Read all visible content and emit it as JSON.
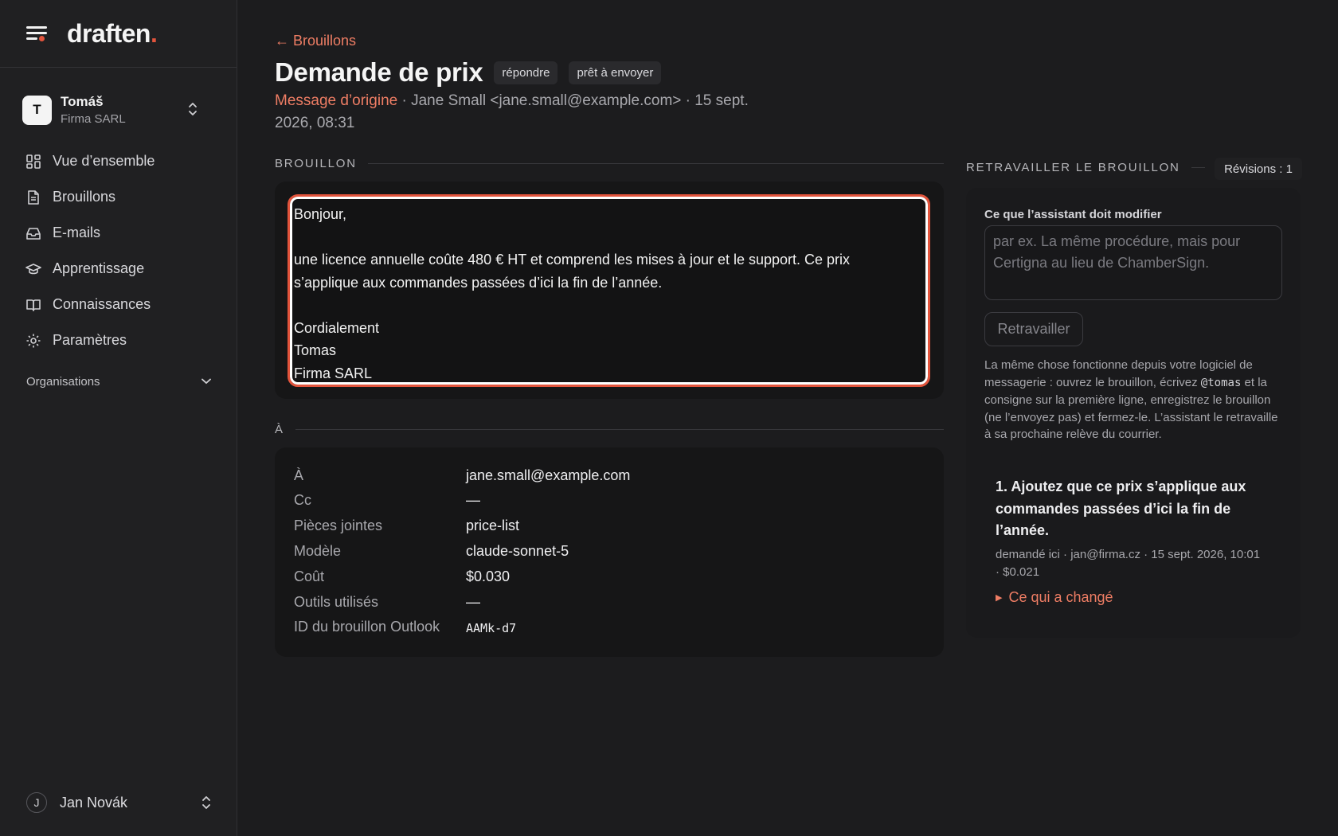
{
  "brand": {
    "name": "draften",
    "dot": "."
  },
  "workspace": {
    "initial": "T",
    "name": "Tomáš",
    "company": "Firma SARL"
  },
  "nav": [
    {
      "label": "Vue d’ensemble",
      "icon": "grid-icon"
    },
    {
      "label": "Brouillons",
      "icon": "document-icon"
    },
    {
      "label": "E-mails",
      "icon": "inbox-icon"
    },
    {
      "label": "Apprentissage",
      "icon": "graduation-cap-icon"
    },
    {
      "label": "Connaissances",
      "icon": "book-icon"
    },
    {
      "label": "Paramètres",
      "icon": "gear-icon"
    }
  ],
  "organisations_label": "Organisations",
  "user": {
    "initial": "J",
    "name": "Jan Novák"
  },
  "header": {
    "back": "← Brouillons",
    "title": "Demande de prix",
    "chips": [
      "répondre",
      "prêt à envoyer"
    ],
    "origin_link": "Message d’origine",
    "meta": " · Jane Small <jane.small@example.com> · 15 sept. 2026, 08:31"
  },
  "draft": {
    "section": "BROUILLON",
    "lines": [
      "Bonjour,",
      "",
      "une licence annuelle coûte 480 € HT et comprend les mises à jour et le support. Ce prix",
      "s’applique aux commandes passées d’ici la fin de l’année.",
      "",
      "Cordialement",
      "Tomas",
      "Firma SARL"
    ]
  },
  "recipients": {
    "section": "À",
    "rows": [
      {
        "key": "À",
        "value": "jane.small@example.com"
      },
      {
        "key": "Cc",
        "value": "—"
      },
      {
        "key": "Pièces jointes",
        "value": "price-list"
      },
      {
        "key": "Modèle",
        "value": "claude-sonnet-5"
      },
      {
        "key": "Coût",
        "value": "$0.030"
      },
      {
        "key": "Outils utilisés",
        "value": "—"
      },
      {
        "key": "ID du brouillon Outlook",
        "value": "AAMk-d7"
      }
    ]
  },
  "rework": {
    "section": "RETRAVAILLER LE BROUILLON",
    "revisions": "Révisions : 1",
    "field_label": "Ce que l’assistant doit modifier",
    "placeholder": "par ex. La même procédure, mais pour Certigna au lieu de ChamberSign.",
    "button": "Retravailler",
    "help_before": "La même chose fonctionne depuis votre logiciel de messagerie : ouvrez le brouillon, écrivez ",
    "help_code": "@tomas",
    "help_after": " et la consigne sur la première ligne, enregistrez le brouillon (ne l’envoyez pas) et fermez-le. L’assistant le retravaille à sa prochaine relève du courrier.",
    "revision_item": {
      "title": "1. Ajoutez que ce prix s’applique aux commandes passées d’ici la fin de l’année.",
      "meta": "demandé ici · jan@firma.cz · 15 sept. 2026, 10:01 · $0.021",
      "changes": "Ce qui a changé"
    }
  },
  "colors": {
    "accent": "#e2543c",
    "link": "#ee7d64",
    "background": "#1c1c1e"
  }
}
